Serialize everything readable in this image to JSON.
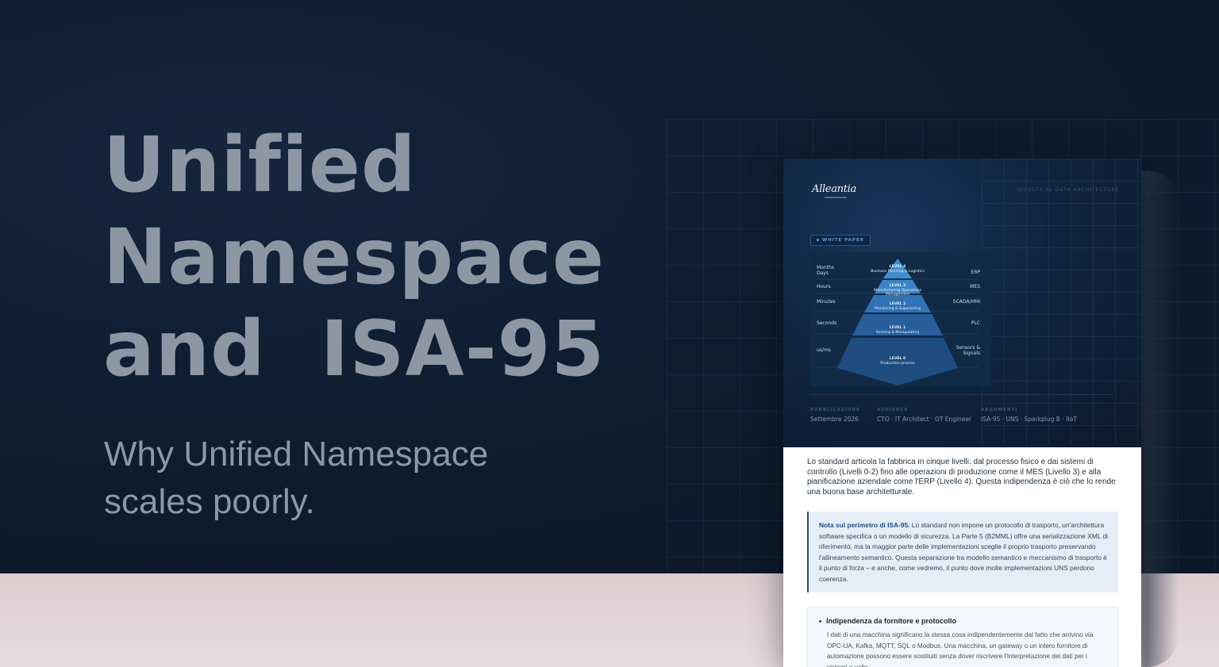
{
  "hero": {
    "title_lines": [
      "Unified",
      "Namespace",
      "and  ISA-95"
    ],
    "subtitle_lines": [
      "Why Unified Namespace",
      "scales poorly."
    ]
  },
  "document": {
    "logo": "Alleantia",
    "kicker": "INDUSTRIAL DATA ARCHITECTURE",
    "badge": "WHITE PAPER",
    "pyramid": {
      "left_labels": [
        "Months\nDays",
        "Hours",
        "Minutes",
        "Seconds",
        "us/ms"
      ],
      "right_labels": [
        "ERP",
        "MES",
        "SCADA/HMI",
        "PLC",
        "Sensors &\nSignals"
      ],
      "levels": [
        {
          "name": "LEVEL 4",
          "desc": "Business Planning & Logistics"
        },
        {
          "name": "LEVEL 3",
          "desc": "Manufacturing Operations Management"
        },
        {
          "name": "LEVEL 2",
          "desc": "Monitoring & Supervising"
        },
        {
          "name": "LEVEL 1",
          "desc": "Sensing & Manipulating"
        },
        {
          "name": "LEVEL 0",
          "desc": "Production process"
        }
      ]
    },
    "meta": [
      {
        "key": "PUBBLICAZIONE",
        "value": "Settembre 2026"
      },
      {
        "key": "AUDIENCE",
        "value": "CTO · IT Architect · OT Engineer"
      },
      {
        "key": "ARGOMENTI",
        "value": "ISA-95 · UNS · Sparkplug B · IIoT"
      }
    ],
    "paragraph": "Lo standard articola la fabbrica in cinque livelli: dal processo fisico e dai sistemi di controllo (Livelli 0-2) fino alle operazioni di produzione come il MES (Livello 3) e alla pianificazione aziendale come l'ERP (Livello 4). Questa indipendenza è ciò che lo rende una buona base architetturale.",
    "note": {
      "lead": "Nota sul perimetro di ISA-95.",
      "text": " Lo standard non impone un protocollo di trasporto, un'architettura software specifica o un modello di sicurezza. La Parte 5 (B2MML) offre una serializzazione XML di riferimento, ma la maggior parte delle implementazioni sceglie il proprio trasporto preservando l'allineamento semantico. Questa separazione tra modello semantico e meccanismo di trasporto è il punto di forza – e anche, come vedremo, il punto dove molte implementazioni UNS perdono coerenza."
    },
    "card": {
      "heading": "Indipendenza da fornitore e protocollo",
      "text": "I dati di una macchina significano la stessa cosa indipendentemente dal fatto che arrivino via OPC-UA, Kafka, MQTT, SQL o Modbus. Una macchina, un gateway o un intero fornitore di automazione possono essere sostituiti senza dover riscrivere l'interpretazione dei dati per i sistemi a valle."
    }
  }
}
